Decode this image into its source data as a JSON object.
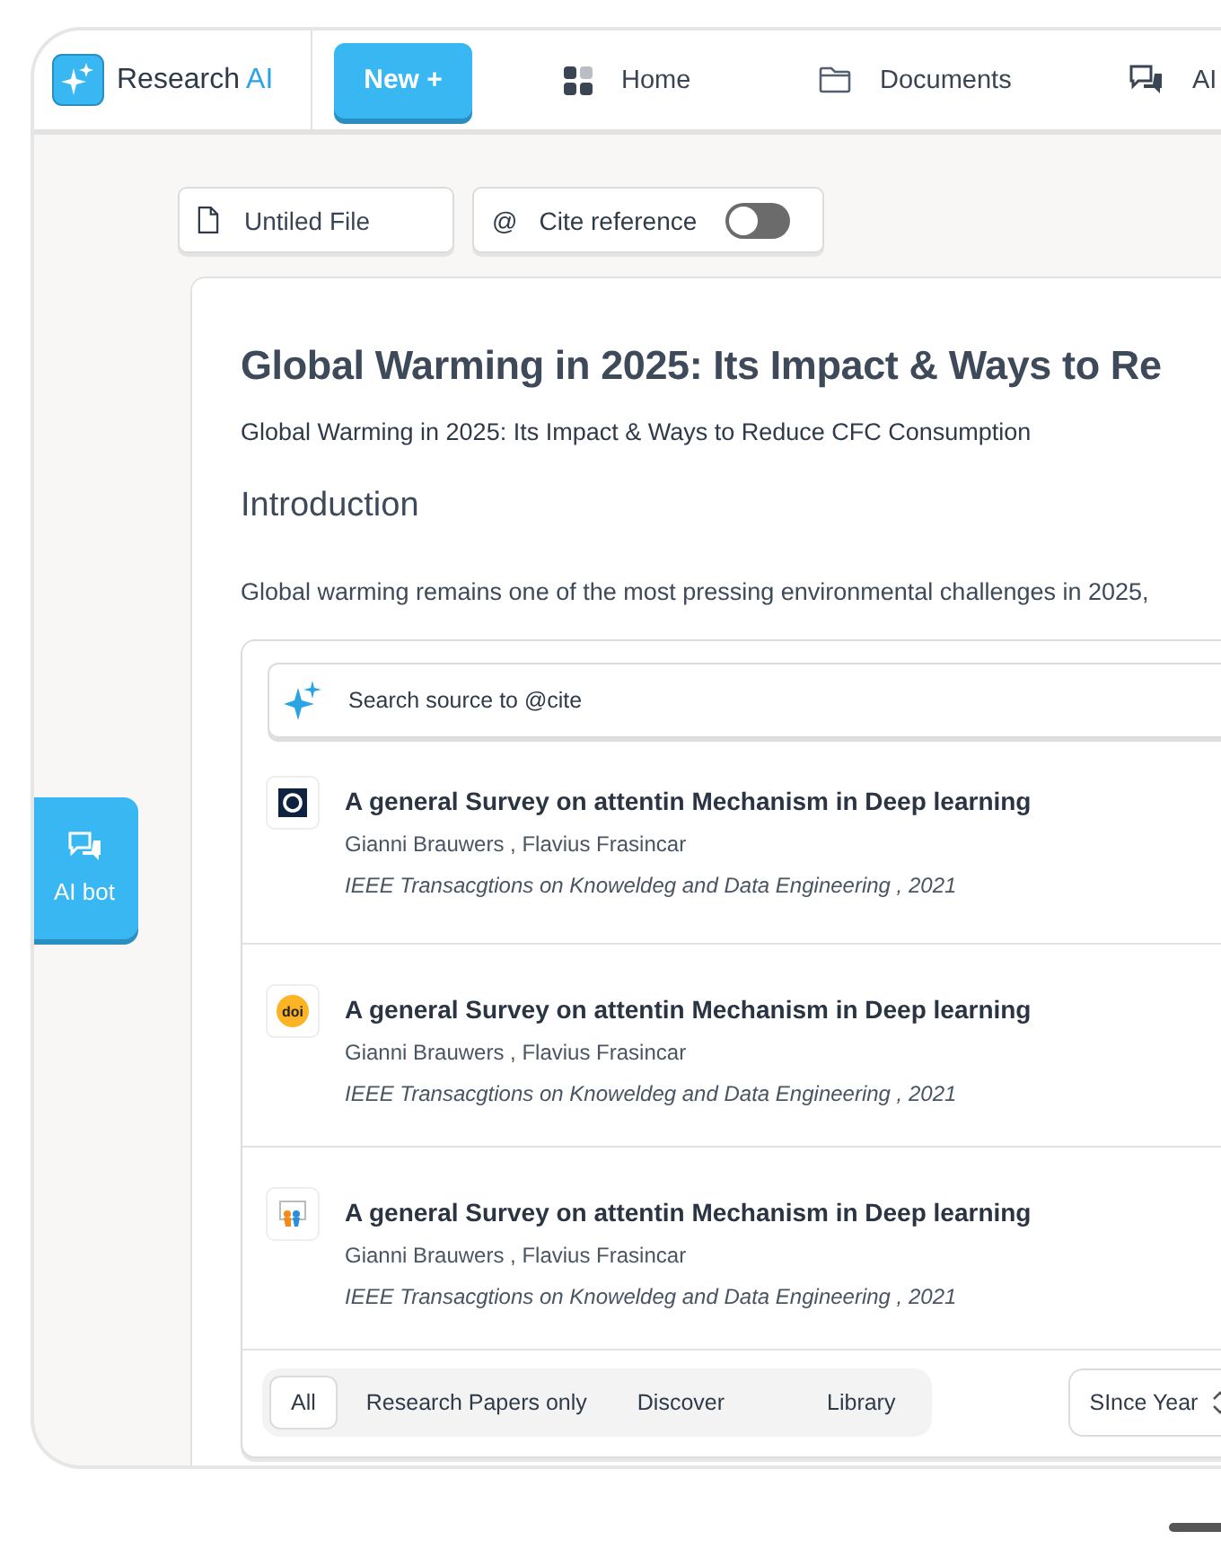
{
  "header": {
    "brand": {
      "name": "Research",
      "accent": "AI"
    },
    "new_button": "New +",
    "nav": [
      {
        "label": "Home"
      },
      {
        "label": "Documents"
      },
      {
        "label": "AI"
      }
    ]
  },
  "toolbar": {
    "file_name": {
      "placeholder": "Untiled File"
    },
    "cite": {
      "symbol": "@",
      "label": "Cite reference",
      "on": false
    }
  },
  "side_button": {
    "label": "AI bot"
  },
  "document": {
    "title": "Global Warming in 2025: Its Impact & Ways to Re",
    "subtitle": "Global Warming in 2025: Its Impact & Ways to Reduce CFC Consumption",
    "section": "Introduction",
    "paragraph": "Global warming remains one of the most pressing environmental challenges in 2025,"
  },
  "cite_popup": {
    "search": {
      "placeholder": "Search source to @cite"
    },
    "results": [
      {
        "kind": "ring",
        "title": "A general Survey on attentin Mechanism in Deep learning",
        "authors": "Gianni Brauwers , Flavius Frasincar",
        "journal": "IEEE Transacgtions on Knoweldeg and Data Engineering , 2021"
      },
      {
        "kind": "badge",
        "badge": "doi",
        "title": "A general Survey on attentin Mechanism in Deep learning",
        "authors": "Gianni Brauwers , Flavius Frasincar",
        "journal": "IEEE Transacgtions on Knoweldeg and Data Engineering , 2021"
      },
      {
        "kind": "people",
        "title": "A general Survey on attentin Mechanism in Deep learning",
        "authors": "Gianni Brauwers , Flavius Frasincar",
        "journal": "IEEE Transacgtions on Knoweldeg and Data Engineering , 2021"
      }
    ],
    "filters": [
      {
        "label": "All",
        "selected": true
      },
      {
        "label": "Research Papers only",
        "selected": false
      },
      {
        "label": "Discover",
        "selected": false
      },
      {
        "label": "Library",
        "selected": false
      }
    ],
    "year_select": {
      "label": "SInce Year"
    }
  }
}
